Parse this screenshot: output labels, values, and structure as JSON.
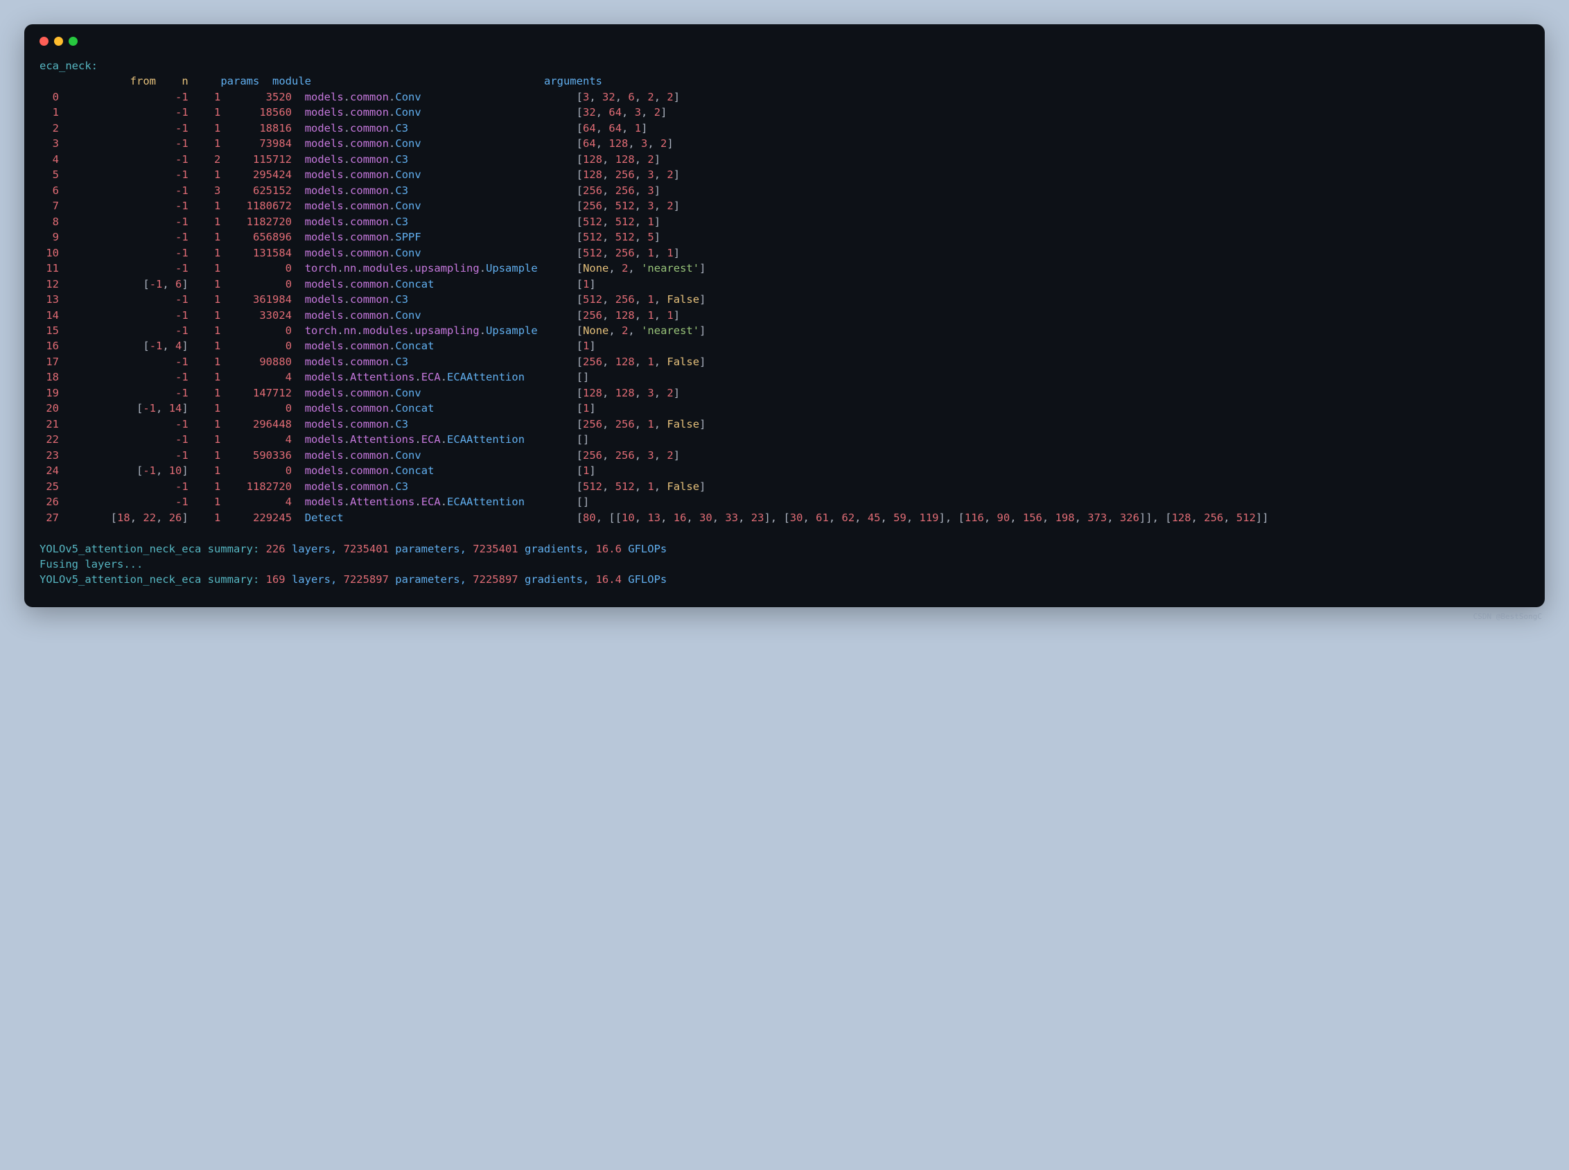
{
  "title": "eca_neck:",
  "headers": {
    "from": "from",
    "n": "n",
    "params": "params",
    "module": "module",
    "arguments": "arguments"
  },
  "rows": [
    {
      "idx": "0",
      "from": "-1",
      "n": "1",
      "params": "3520",
      "module": "models.common.Conv",
      "args": [
        [
          "num",
          "3"
        ],
        [
          "num",
          "32"
        ],
        [
          "num",
          "6"
        ],
        [
          "num",
          "2"
        ],
        [
          "num",
          "2"
        ]
      ]
    },
    {
      "idx": "1",
      "from": "-1",
      "n": "1",
      "params": "18560",
      "module": "models.common.Conv",
      "args": [
        [
          "num",
          "32"
        ],
        [
          "num",
          "64"
        ],
        [
          "num",
          "3"
        ],
        [
          "num",
          "2"
        ]
      ]
    },
    {
      "idx": "2",
      "from": "-1",
      "n": "1",
      "params": "18816",
      "module": "models.common.C3",
      "args": [
        [
          "num",
          "64"
        ],
        [
          "num",
          "64"
        ],
        [
          "num",
          "1"
        ]
      ]
    },
    {
      "idx": "3",
      "from": "-1",
      "n": "1",
      "params": "73984",
      "module": "models.common.Conv",
      "args": [
        [
          "num",
          "64"
        ],
        [
          "num",
          "128"
        ],
        [
          "num",
          "3"
        ],
        [
          "num",
          "2"
        ]
      ]
    },
    {
      "idx": "4",
      "from": "-1",
      "n": "2",
      "params": "115712",
      "module": "models.common.C3",
      "args": [
        [
          "num",
          "128"
        ],
        [
          "num",
          "128"
        ],
        [
          "num",
          "2"
        ]
      ]
    },
    {
      "idx": "5",
      "from": "-1",
      "n": "1",
      "params": "295424",
      "module": "models.common.Conv",
      "args": [
        [
          "num",
          "128"
        ],
        [
          "num",
          "256"
        ],
        [
          "num",
          "3"
        ],
        [
          "num",
          "2"
        ]
      ]
    },
    {
      "idx": "6",
      "from": "-1",
      "n": "3",
      "params": "625152",
      "module": "models.common.C3",
      "args": [
        [
          "num",
          "256"
        ],
        [
          "num",
          "256"
        ],
        [
          "num",
          "3"
        ]
      ]
    },
    {
      "idx": "7",
      "from": "-1",
      "n": "1",
      "params": "1180672",
      "module": "models.common.Conv",
      "args": [
        [
          "num",
          "256"
        ],
        [
          "num",
          "512"
        ],
        [
          "num",
          "3"
        ],
        [
          "num",
          "2"
        ]
      ]
    },
    {
      "idx": "8",
      "from": "-1",
      "n": "1",
      "params": "1182720",
      "module": "models.common.C3",
      "args": [
        [
          "num",
          "512"
        ],
        [
          "num",
          "512"
        ],
        [
          "num",
          "1"
        ]
      ]
    },
    {
      "idx": "9",
      "from": "-1",
      "n": "1",
      "params": "656896",
      "module": "models.common.SPPF",
      "args": [
        [
          "num",
          "512"
        ],
        [
          "num",
          "512"
        ],
        [
          "num",
          "5"
        ]
      ]
    },
    {
      "idx": "10",
      "from": "-1",
      "n": "1",
      "params": "131584",
      "module": "models.common.Conv",
      "args": [
        [
          "num",
          "512"
        ],
        [
          "num",
          "256"
        ],
        [
          "num",
          "1"
        ],
        [
          "num",
          "1"
        ]
      ]
    },
    {
      "idx": "11",
      "from": "-1",
      "n": "1",
      "params": "0",
      "module": "torch.nn.modules.upsampling.Upsample",
      "args": [
        [
          "kw",
          "None"
        ],
        [
          "num",
          "2"
        ],
        [
          "str",
          "'nearest'"
        ]
      ]
    },
    {
      "idx": "12",
      "from_list": [
        "-1",
        "6"
      ],
      "n": "1",
      "params": "0",
      "module": "models.common.Concat",
      "args": [
        [
          "num",
          "1"
        ]
      ]
    },
    {
      "idx": "13",
      "from": "-1",
      "n": "1",
      "params": "361984",
      "module": "models.common.C3",
      "args": [
        [
          "num",
          "512"
        ],
        [
          "num",
          "256"
        ],
        [
          "num",
          "1"
        ],
        [
          "kw",
          "False"
        ]
      ]
    },
    {
      "idx": "14",
      "from": "-1",
      "n": "1",
      "params": "33024",
      "module": "models.common.Conv",
      "args": [
        [
          "num",
          "256"
        ],
        [
          "num",
          "128"
        ],
        [
          "num",
          "1"
        ],
        [
          "num",
          "1"
        ]
      ]
    },
    {
      "idx": "15",
      "from": "-1",
      "n": "1",
      "params": "0",
      "module": "torch.nn.modules.upsampling.Upsample",
      "args": [
        [
          "kw",
          "None"
        ],
        [
          "num",
          "2"
        ],
        [
          "str",
          "'nearest'"
        ]
      ]
    },
    {
      "idx": "16",
      "from_list": [
        "-1",
        "4"
      ],
      "n": "1",
      "params": "0",
      "module": "models.common.Concat",
      "args": [
        [
          "num",
          "1"
        ]
      ]
    },
    {
      "idx": "17",
      "from": "-1",
      "n": "1",
      "params": "90880",
      "module": "models.common.C3",
      "args": [
        [
          "num",
          "256"
        ],
        [
          "num",
          "128"
        ],
        [
          "num",
          "1"
        ],
        [
          "kw",
          "False"
        ]
      ]
    },
    {
      "idx": "18",
      "from": "-1",
      "n": "1",
      "params": "4",
      "module": "models.Attentions.ECA.ECAAttention",
      "args": []
    },
    {
      "idx": "19",
      "from": "-1",
      "n": "1",
      "params": "147712",
      "module": "models.common.Conv",
      "args": [
        [
          "num",
          "128"
        ],
        [
          "num",
          "128"
        ],
        [
          "num",
          "3"
        ],
        [
          "num",
          "2"
        ]
      ]
    },
    {
      "idx": "20",
      "from_list": [
        "-1",
        "14"
      ],
      "n": "1",
      "params": "0",
      "module": "models.common.Concat",
      "args": [
        [
          "num",
          "1"
        ]
      ]
    },
    {
      "idx": "21",
      "from": "-1",
      "n": "1",
      "params": "296448",
      "module": "models.common.C3",
      "args": [
        [
          "num",
          "256"
        ],
        [
          "num",
          "256"
        ],
        [
          "num",
          "1"
        ],
        [
          "kw",
          "False"
        ]
      ]
    },
    {
      "idx": "22",
      "from": "-1",
      "n": "1",
      "params": "4",
      "module": "models.Attentions.ECA.ECAAttention",
      "args": []
    },
    {
      "idx": "23",
      "from": "-1",
      "n": "1",
      "params": "590336",
      "module": "models.common.Conv",
      "args": [
        [
          "num",
          "256"
        ],
        [
          "num",
          "256"
        ],
        [
          "num",
          "3"
        ],
        [
          "num",
          "2"
        ]
      ]
    },
    {
      "idx": "24",
      "from_list": [
        "-1",
        "10"
      ],
      "n": "1",
      "params": "0",
      "module": "models.common.Concat",
      "args": [
        [
          "num",
          "1"
        ]
      ]
    },
    {
      "idx": "25",
      "from": "-1",
      "n": "1",
      "params": "1182720",
      "module": "models.common.C3",
      "args": [
        [
          "num",
          "512"
        ],
        [
          "num",
          "512"
        ],
        [
          "num",
          "1"
        ],
        [
          "kw",
          "False"
        ]
      ]
    },
    {
      "idx": "26",
      "from": "-1",
      "n": "1",
      "params": "4",
      "module": "models.Attentions.ECA.ECAAttention",
      "args": []
    }
  ],
  "detect_row": {
    "idx": "27",
    "from_list": [
      "18",
      "22",
      "26"
    ],
    "n": "1",
    "params": "229245",
    "module": "Detect",
    "nc": "80",
    "anchors": [
      [
        "10",
        "13",
        "16",
        "30",
        "33",
        "23"
      ],
      [
        "30",
        "61",
        "62",
        "45",
        "59",
        "119"
      ],
      [
        "116",
        "90",
        "156",
        "198",
        "373",
        "326"
      ]
    ],
    "ch": [
      "128",
      "256",
      "512"
    ]
  },
  "summary1": {
    "name": "YOLOv5_attention_neck_eca summary: ",
    "layers": "226",
    "layers_lbl": " layers, ",
    "params": "7235401",
    "params_lbl": " parameters, ",
    "grads": "7235401",
    "grads_lbl": " gradients, ",
    "gflops": "16.6",
    "gflops_lbl": " GFLOPs"
  },
  "fusing": "Fusing layers...",
  "summary2": {
    "name": "YOLOv5_attention_neck_eca summary: ",
    "layers": "169",
    "layers_lbl": " layers, ",
    "params": "7225897",
    "params_lbl": " parameters, ",
    "grads": "7225897",
    "grads_lbl": " gradients, ",
    "gflops": "16.4",
    "gflops_lbl": " GFLOPs"
  },
  "watermark": "CSDN @BestSongC"
}
